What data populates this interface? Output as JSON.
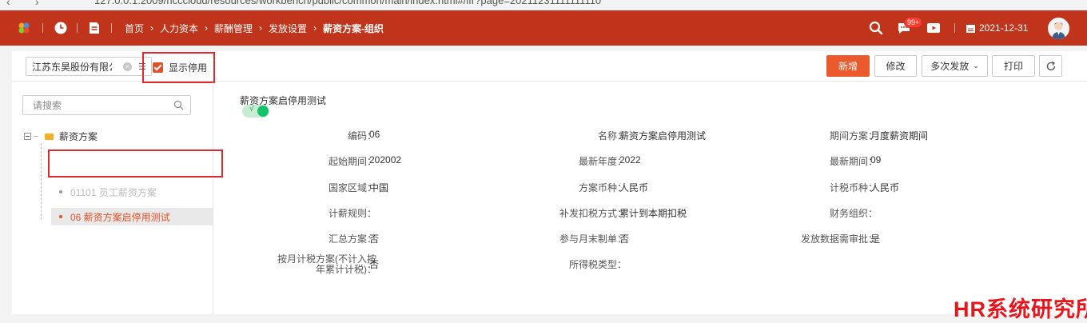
{
  "browser": {
    "url": "127.0.0.1:2009/ncccloud/resources/workbench/public/common/main/index.html#/ifr?page=20211231111111110"
  },
  "topbar": {
    "breadcrumbs": [
      "首页",
      "人力资本",
      "薪酬管理",
      "发放设置",
      "薪资方案-组织"
    ],
    "message_badge": "99+",
    "date": "2021-12-31",
    "bg_color": "#c0341b"
  },
  "toolbar": {
    "org_value": "江苏东昊股份有限公司",
    "show_disabled_label": "显示停用",
    "show_disabled_checked": true,
    "buttons": {
      "add": "新增",
      "edit": "修改",
      "multi_release": "多次发放",
      "print": "打印"
    }
  },
  "tree": {
    "search_placeholder": "请搜索",
    "root": "薪资方案",
    "items": [
      {
        "label": "01101 员工薪资方案",
        "state": "disabled"
      },
      {
        "label": "06 薪资方案启停用测试",
        "state": "selected"
      }
    ]
  },
  "detail": {
    "title": "薪资方案启停用测试",
    "enabled": true,
    "toggle_mark": "√",
    "fields": [
      {
        "label": "编码",
        "value": "06"
      },
      {
        "label": "名称",
        "value": "薪资方案启停用测试"
      },
      {
        "label": "期间方案",
        "value": "月度薪资期间"
      },
      {
        "label": "起始期间",
        "value": "202002"
      },
      {
        "label": "最新年度",
        "value": "2022"
      },
      {
        "label": "最新期间",
        "value": "09"
      },
      {
        "label": "国家区域",
        "value": "中国"
      },
      {
        "label": "方案币种",
        "value": "人民币"
      },
      {
        "label": "计税币种",
        "value": "人民币"
      },
      {
        "label": "计薪规则",
        "value": ""
      },
      {
        "label": "补发扣税方式",
        "value": "累计到本期扣税"
      },
      {
        "label": "财务组织",
        "value": ""
      },
      {
        "label": "汇总方案",
        "value": "否"
      },
      {
        "label": "参与月末制单",
        "value": "否"
      },
      {
        "label": "发放数据需审批",
        "value": "是"
      },
      {
        "label": "按月计税方案(不计入按年累计计税)",
        "value": "否"
      },
      {
        "label": "所得税类型",
        "value": ""
      }
    ]
  },
  "watermark": "HR系统研究所",
  "colors": {
    "accent": "#ea5a2c",
    "highlight_border": "#e0292c",
    "toggle_on": "#15c26a"
  }
}
